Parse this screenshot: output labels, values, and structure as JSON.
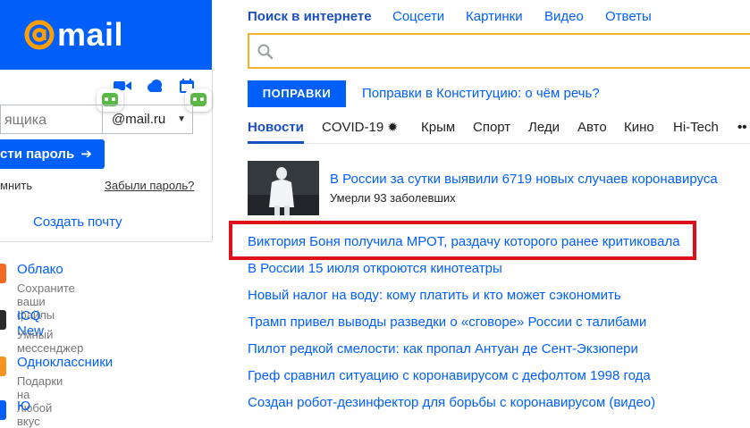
{
  "brand": {
    "logo_text": "mail",
    "accent": "#005ff9"
  },
  "login": {
    "input_placeholder": "ящика",
    "domain": "@mail.ru",
    "submit_label": "сти пароль",
    "submit_arrow": "➔",
    "remember_label": "мнить",
    "forgot_label": "Забыли пароль?",
    "create_label": "Создать почту"
  },
  "service_icons": [
    "video-icon",
    "cloud-icon",
    "calendar-icon"
  ],
  "projects": [
    {
      "name": "Облако",
      "desc": "Сохраните ваши файлы",
      "color": "#f26a21"
    },
    {
      "name": "ICQ New",
      "desc": "Умный мессенджер",
      "color": "#2a2a2a"
    },
    {
      "name": "Одноклассники",
      "desc": "Подарки на любой вкус",
      "color": "#f7931e"
    },
    {
      "name": "Ю",
      "desc": "",
      "color": "#005ff9"
    }
  ],
  "top_nav": [
    "Поиск в интернете",
    "Соцсети",
    "Картинки",
    "Видео",
    "Ответы"
  ],
  "promo": {
    "badge": "ПОПРАВКИ",
    "text": "Поправки в Конституцию: о чём речь?"
  },
  "news_tabs": [
    "Новости",
    "COVID-19",
    "Крым",
    "Спорт",
    "Леди",
    "Авто",
    "Кино",
    "Hi-Tech",
    "••"
  ],
  "featured": {
    "title": "В России за сутки выявили 6719 новых случаев коронавируса",
    "subtitle": "Умерли 93 заболевших"
  },
  "news_items": [
    "Виктория Боня получила МРОТ, раздачу которого ранее критиковала",
    "В России 15 июля откроются кинотеатры",
    "Новый налог на воду: кому платить и кто может сэкономить",
    "Трамп привел выводы разведки о «сговоре» России с талибами",
    "Пилот редкой смелости: как пропал Антуан де Сент-Экзюпери",
    "Греф сравнил ситуацию с коронавирусом с дефолтом 1998 года",
    "Создан робот-дезинфектор для борьбы с коронавирусом (видео)"
  ],
  "highlight_color": "#e0101b"
}
